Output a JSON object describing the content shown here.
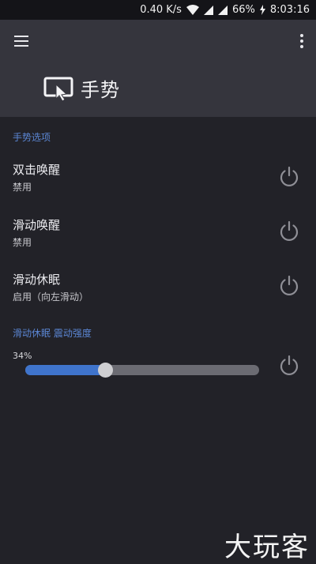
{
  "status_bar": {
    "network_speed": "0.40 K/s",
    "battery": "66%",
    "time": "8:03:16"
  },
  "header": {
    "title": "手势",
    "icon": "gesture-tap-icon"
  },
  "sections": {
    "gestures_header": "手势选项",
    "vibration_header": "滑动休眠 震动强度"
  },
  "items": [
    {
      "title": "双击唤醒",
      "subtitle": "禁用",
      "enabled": false
    },
    {
      "title": "滑动唤醒",
      "subtitle": "禁用",
      "enabled": false
    },
    {
      "title": "滑动休眠",
      "subtitle": "启用（向左滑动）",
      "enabled": true
    }
  ],
  "slider": {
    "label": "34%",
    "value": 0.34
  },
  "watermark": "大玩客",
  "colors": {
    "accent": "#5b86d3",
    "slider_fill": "#3f74cc",
    "background": "#222228",
    "header": "#35353d"
  }
}
